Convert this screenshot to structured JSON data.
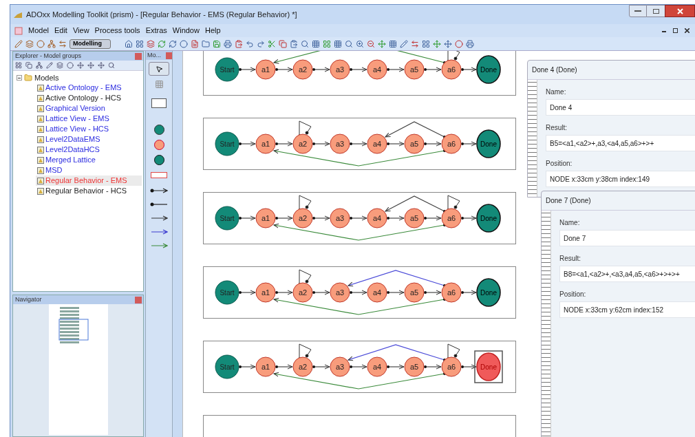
{
  "window": {
    "title": "ADOxx Modelling Toolkit (prism) - [Regular Behavior - EMS (Regular Behavior) *]"
  },
  "menu": [
    "Model",
    "Edit",
    "View",
    "Process tools",
    "Extras",
    "Window",
    "Help"
  ],
  "toolbar": {
    "mode": "Modelling"
  },
  "explorer": {
    "title": "Explorer - Model groups",
    "tree": {
      "label": "Models",
      "expanded": true,
      "children": [
        {
          "label": "Active Ontology - EMS",
          "color": "#2a2ae0",
          "selected": false
        },
        {
          "label": "Active Ontology - HCS",
          "color": "#222222",
          "selected": false
        },
        {
          "label": "Graphical Version",
          "color": "#2a2ae0",
          "selected": false
        },
        {
          "label": "Lattice View - EMS",
          "color": "#2a2ae0",
          "selected": false
        },
        {
          "label": "Lattice View - HCS",
          "color": "#2a2ae0",
          "selected": false
        },
        {
          "label": "Level2DataEMS",
          "color": "#2a2ae0",
          "selected": false
        },
        {
          "label": "Level2DataHCS",
          "color": "#2a2ae0",
          "selected": false
        },
        {
          "label": "Merged Lattice",
          "color": "#2a2ae0",
          "selected": false
        },
        {
          "label": "MSD",
          "color": "#2a2ae0",
          "selected": false
        },
        {
          "label": "Regular Behavior - EMS",
          "color": "#ee3333",
          "selected": true
        },
        {
          "label": "Regular Behavior - HCS",
          "color": "#222222",
          "selected": false
        }
      ]
    }
  },
  "navigator": {
    "title": "Navigator"
  },
  "palette": {
    "title": "Mo..."
  },
  "models": [
    {
      "nodes": [
        {
          "label": "Start",
          "kind": "start",
          "selected": false
        },
        {
          "label": "a1",
          "kind": "activity",
          "selected": false
        },
        {
          "label": "a2",
          "kind": "activity",
          "selected": false
        },
        {
          "label": "a3",
          "kind": "activity",
          "selected": false
        },
        {
          "label": "a4",
          "kind": "activity",
          "selected": false
        },
        {
          "label": "a5",
          "kind": "activity",
          "selected": false
        },
        {
          "label": "a6",
          "kind": "activity",
          "selected": false
        },
        {
          "label": "Done",
          "kind": "done",
          "selected": false
        }
      ]
    },
    {
      "nodes": [
        {
          "label": "Start",
          "kind": "start",
          "selected": false
        },
        {
          "label": "a1",
          "kind": "activity",
          "selected": false
        },
        {
          "label": "a2",
          "kind": "activity",
          "selected": false
        },
        {
          "label": "a3",
          "kind": "activity",
          "selected": false
        },
        {
          "label": "a4",
          "kind": "activity",
          "selected": false
        },
        {
          "label": "a5",
          "kind": "activity",
          "selected": false
        },
        {
          "label": "a6",
          "kind": "activity",
          "selected": false
        },
        {
          "label": "Done",
          "kind": "done",
          "selected": false
        }
      ]
    },
    {
      "nodes": [
        {
          "label": "Start",
          "kind": "start",
          "selected": false
        },
        {
          "label": "a1",
          "kind": "activity",
          "selected": false
        },
        {
          "label": "a2",
          "kind": "activity",
          "selected": false
        },
        {
          "label": "a3",
          "kind": "activity",
          "selected": false
        },
        {
          "label": "a4",
          "kind": "activity",
          "selected": false
        },
        {
          "label": "a5",
          "kind": "activity",
          "selected": false
        },
        {
          "label": "a6",
          "kind": "activity",
          "selected": false
        },
        {
          "label": "Done",
          "kind": "done",
          "selected": false
        }
      ]
    },
    {
      "nodes": [
        {
          "label": "Start",
          "kind": "start",
          "selected": false
        },
        {
          "label": "a1",
          "kind": "activity",
          "selected": false
        },
        {
          "label": "a2",
          "kind": "activity",
          "selected": false
        },
        {
          "label": "a3",
          "kind": "activity",
          "selected": false
        },
        {
          "label": "a4",
          "kind": "activity",
          "selected": false
        },
        {
          "label": "a5",
          "kind": "activity",
          "selected": false
        },
        {
          "label": "a6",
          "kind": "activity",
          "selected": false
        },
        {
          "label": "Done",
          "kind": "done",
          "selected": false
        }
      ]
    },
    {
      "nodes": [
        {
          "label": "Start",
          "kind": "start",
          "selected": false
        },
        {
          "label": "a1",
          "kind": "activity",
          "selected": false
        },
        {
          "label": "a2",
          "kind": "activity",
          "selected": false
        },
        {
          "label": "a3",
          "kind": "activity",
          "selected": false
        },
        {
          "label": "a4",
          "kind": "activity",
          "selected": false
        },
        {
          "label": "a5",
          "kind": "activity",
          "selected": false
        },
        {
          "label": "a6",
          "kind": "activity",
          "selected": false
        },
        {
          "label": "Done",
          "kind": "done",
          "selected": true
        }
      ]
    }
  ],
  "properties": [
    {
      "title": "Done 4 (Done)",
      "fields": [
        {
          "label": "Name:",
          "value": "Done 4"
        },
        {
          "label": "Result:",
          "value": "B5=<a1,<a2>+,a3,<a4,a5,a6>+>+"
        },
        {
          "label": "Position:",
          "value": "NODE x:33cm y:38cm index:149"
        }
      ]
    },
    {
      "title": "Done 7 (Done)",
      "fields": [
        {
          "label": "Name:",
          "value": "Done 7"
        },
        {
          "label": "Result:",
          "value": "B8=<a1,<a2>+,<a3,a4,a5,<a6>+>+>+"
        },
        {
          "label": "Position:",
          "value": "NODE x:33cm y:62cm index:152"
        }
      ]
    }
  ]
}
